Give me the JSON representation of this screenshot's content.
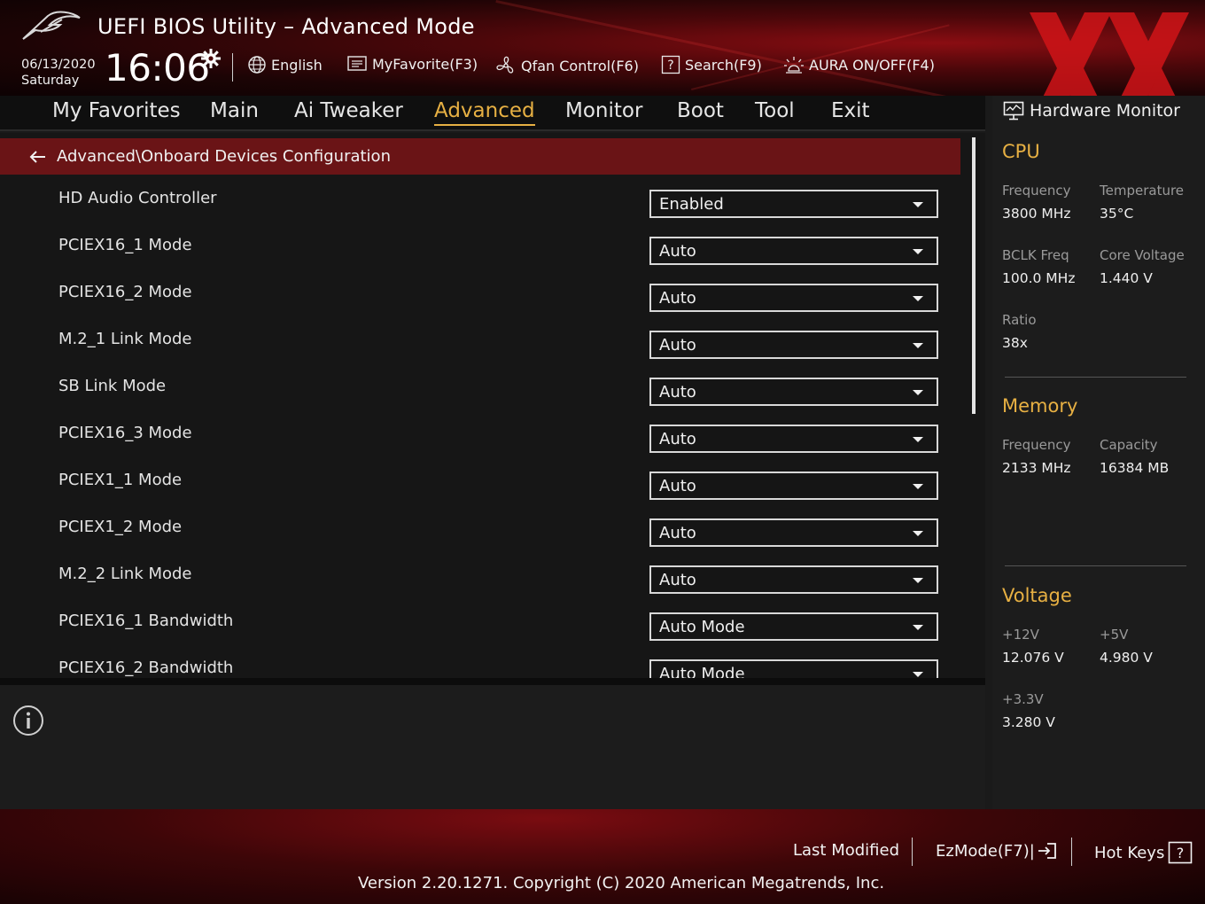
{
  "header": {
    "title": "UEFI BIOS Utility – Advanced Mode",
    "date": "06/13/2020",
    "day": "Saturday",
    "time": "16:06",
    "toolbar": {
      "language": "English",
      "my_favorite": "MyFavorite(F3)",
      "qfan": "Qfan Control(F6)",
      "search": "Search(F9)",
      "aura": "AURA ON/OFF(F4)"
    }
  },
  "nav": {
    "tabs": [
      "My Favorites",
      "Main",
      "Ai Tweaker",
      "Advanced",
      "Monitor",
      "Boot",
      "Tool",
      "Exit"
    ],
    "active": "Advanced"
  },
  "breadcrumb": "Advanced\\Onboard Devices Configuration",
  "settings": [
    {
      "label": "HD Audio Controller",
      "value": "Enabled"
    },
    {
      "label": "PCIEX16_1 Mode",
      "value": "Auto"
    },
    {
      "label": "PCIEX16_2 Mode",
      "value": "Auto"
    },
    {
      "label": "M.2_1 Link Mode",
      "value": "Auto"
    },
    {
      "label": "SB Link Mode",
      "value": "Auto"
    },
    {
      "label": "PCIEX16_3 Mode",
      "value": "Auto"
    },
    {
      "label": "PCIEX1_1 Mode",
      "value": "Auto"
    },
    {
      "label": "PCIEX1_2 Mode",
      "value": "Auto"
    },
    {
      "label": "M.2_2 Link Mode",
      "value": "Auto"
    },
    {
      "label": "PCIEX16_1 Bandwidth",
      "value": "Auto Mode"
    },
    {
      "label": "PCIEX16_2 Bandwidth",
      "value": "Auto Mode"
    }
  ],
  "hardware_monitor": {
    "title": "Hardware Monitor",
    "cpu": {
      "section": "CPU",
      "frequency_label": "Frequency",
      "frequency": "3800 MHz",
      "temperature_label": "Temperature",
      "temperature": "35°C",
      "bclk_label": "BCLK Freq",
      "bclk": "100.0 MHz",
      "core_voltage_label": "Core Voltage",
      "core_voltage": "1.440 V",
      "ratio_label": "Ratio",
      "ratio": "38x"
    },
    "memory": {
      "section": "Memory",
      "frequency_label": "Frequency",
      "frequency": "2133 MHz",
      "capacity_label": "Capacity",
      "capacity": "16384 MB"
    },
    "voltage": {
      "section": "Voltage",
      "v12_label": "+12V",
      "v12": "12.076 V",
      "v5_label": "+5V",
      "v5": "4.980 V",
      "v33_label": "+3.3V",
      "v33": "3.280 V"
    }
  },
  "footer": {
    "last_modified": "Last Modified",
    "ezmode": "EzMode(F7)|",
    "hot_keys": "Hot Keys",
    "copyright": "Version 2.20.1271. Copyright (C) 2020 American Megatrends, Inc."
  },
  "colors": {
    "accent": "#e7b043",
    "breadcrumb_bg": "#6a1416",
    "panel_bg": "#1c1c1c"
  }
}
